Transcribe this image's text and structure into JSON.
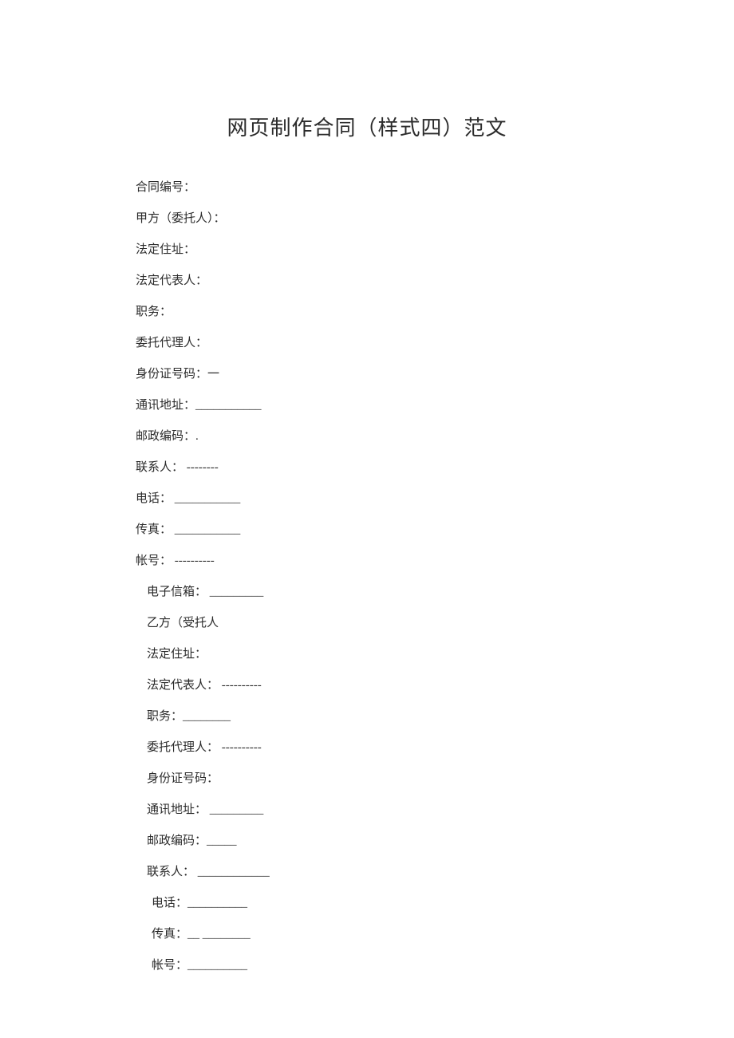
{
  "title": "网页制作合同（样式四）范文",
  "lines": [
    {
      "cls": "line",
      "text": "合同编号："
    },
    {
      "cls": "line",
      "text": "甲方（委托人）："
    },
    {
      "cls": "line",
      "text": "法定住址："
    },
    {
      "cls": "line",
      "text": "法定代表人："
    },
    {
      "cls": "line",
      "text": "职务："
    },
    {
      "cls": "line",
      "text": "委托代理人："
    },
    {
      "cls": "line",
      "text": "身份证号码：一"
    },
    {
      "cls": "line",
      "text": "通讯地址：___________"
    },
    {
      "cls": "line",
      "text": "邮政编码：."
    },
    {
      "cls": "line",
      "text": "联系人： --------"
    },
    {
      "cls": "line",
      "text": "电话： ___________"
    },
    {
      "cls": "line",
      "text": "传真： ___________"
    },
    {
      "cls": "line",
      "text": "帐号： ----------"
    },
    {
      "cls": "line indent1",
      "text": "电子信箱： _________"
    },
    {
      "cls": "line indent1",
      "text": "乙方（受托人"
    },
    {
      "cls": "line indent1",
      "text": "法定住址："
    },
    {
      "cls": "line indent1",
      "text": "法定代表人： ----------"
    },
    {
      "cls": "line indent1",
      "text": "职务：________"
    },
    {
      "cls": "line indent1",
      "text": "委托代理人： ----------"
    },
    {
      "cls": "line indent1",
      "text": "身份证号码："
    },
    {
      "cls": "line indent1",
      "text": "通讯地址： _________"
    },
    {
      "cls": "line indent1",
      "text": "邮政编码：_____"
    },
    {
      "cls": "line indent1",
      "text": "联系人： ____________"
    },
    {
      "cls": "line indent2",
      "text": "电话：__________"
    },
    {
      "cls": "line indent2",
      "text": "传真：__  ________"
    },
    {
      "cls": "line indent2",
      "text": "帐号：__________"
    }
  ]
}
